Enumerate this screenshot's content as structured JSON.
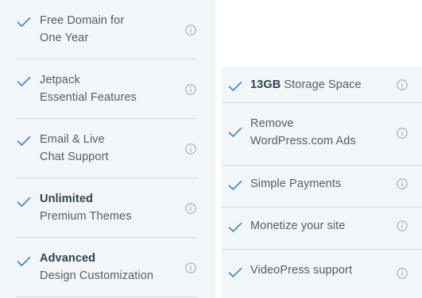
{
  "colors": {
    "check": "#4a8cc7",
    "panel_bg": "#f3f6f8",
    "divider": "#d8dde1",
    "text": "#555d66",
    "bold_text": "#2e4453",
    "info_icon": "#a2aab1"
  },
  "left_features": [
    {
      "line1_bold": "",
      "line1": "Free Domain for",
      "line2": "One Year",
      "icon": "checkmark-icon",
      "info_icon": "info-icon"
    },
    {
      "line1_bold": "",
      "line1": "Jetpack",
      "line2": "Essential Features",
      "icon": "checkmark-icon",
      "info_icon": "info-icon"
    },
    {
      "line1_bold": "",
      "line1": "Email & Live",
      "line2": "Chat Support",
      "icon": "checkmark-icon",
      "info_icon": "info-icon"
    },
    {
      "line1_bold": "Unlimited",
      "line1": "",
      "line2": "Premium Themes",
      "icon": "checkmark-icon",
      "info_icon": "info-icon"
    },
    {
      "line1_bold": "Advanced",
      "line1": "",
      "line2": "Design Customization",
      "icon": "checkmark-icon",
      "info_icon": "info-icon"
    }
  ],
  "right_features": [
    {
      "bold": "13GB",
      "text": " Storage Space",
      "line2": "",
      "icon": "checkmark-icon",
      "info_icon": "info-icon"
    },
    {
      "bold": "",
      "text": "Remove",
      "line2": "WordPress.com Ads",
      "icon": "checkmark-icon",
      "info_icon": "info-icon"
    },
    {
      "bold": "",
      "text": "Simple Payments",
      "line2": "",
      "icon": "checkmark-icon",
      "info_icon": "info-icon"
    },
    {
      "bold": "",
      "text": "Monetize your site",
      "line2": "",
      "icon": "checkmark-icon",
      "info_icon": "info-icon"
    },
    {
      "bold": "",
      "text": "VideoPress support",
      "line2": "",
      "icon": "checkmark-icon",
      "info_icon": "info-icon"
    }
  ]
}
